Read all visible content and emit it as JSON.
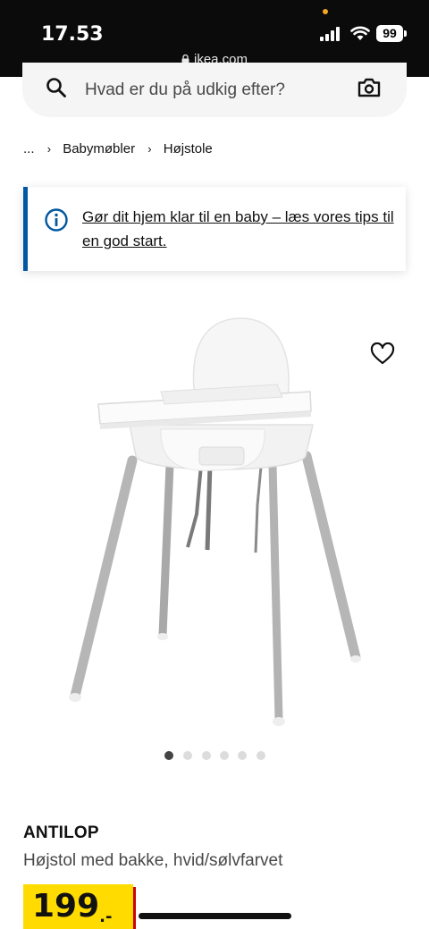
{
  "status_bar": {
    "time": "17.53",
    "battery": "99",
    "url": "ikea.com"
  },
  "search": {
    "placeholder": "Hvad er du på udkig efter?",
    "icons": [
      "search-icon",
      "camera-icon"
    ]
  },
  "breadcrumb": {
    "items": [
      "...",
      "Babymøbler",
      "Højstole"
    ]
  },
  "notice": {
    "text": "Gør dit hjem klar til en baby – læs vores tips til en god start.",
    "icon": "info-icon",
    "accent": "#0058a3"
  },
  "gallery": {
    "image_count": 6,
    "active_index": 0,
    "favourite_icon": "heart-icon"
  },
  "product": {
    "name": "ANTILOP",
    "description": "Højstol med bakke, hvid/sølvfarvet",
    "price_int": "199",
    "price_dec": ".-",
    "price_bg": "#ffdb00",
    "price_shadow": "#cc0008"
  }
}
